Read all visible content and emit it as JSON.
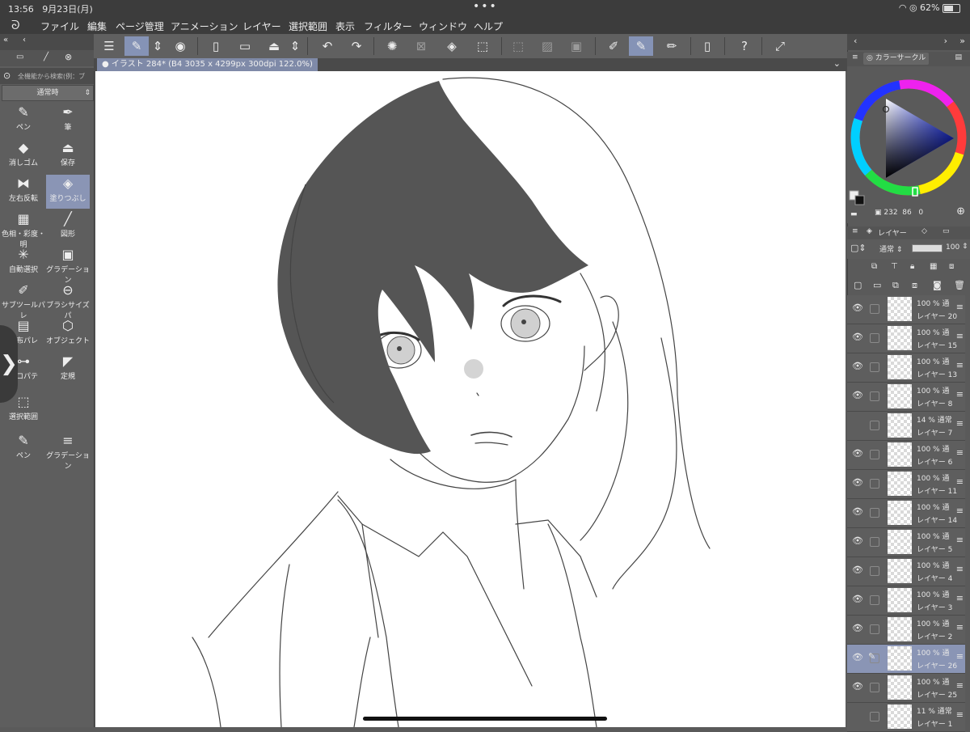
{
  "status": {
    "time": "13:56",
    "date": "9月23日(月)",
    "dots": "•••",
    "battery": "62%"
  },
  "menu": [
    "ファイル",
    "編集",
    "ページ管理",
    "アニメーション",
    "レイヤー",
    "選択範囲",
    "表示",
    "フィルター",
    "ウィンドウ",
    "ヘルプ"
  ],
  "document": {
    "tab_title": "イラスト 284* (B4 3035 x 4299px 300dpi 122.0%)"
  },
  "left_panel": {
    "search_placeholder": "全機能から検索(例：ブ",
    "mode": "通常時",
    "tools": [
      {
        "label": "ペン",
        "icon": "pen-icon",
        "glyph": "✎"
      },
      {
        "label": "筆",
        "icon": "brush-icon",
        "glyph": "✒"
      },
      {
        "label": "消しゴム",
        "icon": "eraser-icon",
        "glyph": "◆"
      },
      {
        "label": "保存",
        "icon": "save-icon",
        "glyph": "⏏"
      },
      {
        "label": "左右反転",
        "icon": "flip-icon",
        "glyph": "⧓"
      },
      {
        "label": "塗りつぶし",
        "icon": "fill-icon",
        "glyph": "◈"
      },
      {
        "label": "色相・彩度・明",
        "icon": "hue-icon",
        "glyph": "▦"
      },
      {
        "label": "図形",
        "icon": "shape-icon",
        "glyph": "╱"
      },
      {
        "label": "自動選択",
        "icon": "auto-select-icon",
        "glyph": "✳"
      },
      {
        "label": "グラデーション",
        "icon": "gradient-icon",
        "glyph": "▣"
      },
      {
        "label": "サブツールパレ",
        "icon": "subtool-icon",
        "glyph": "✐"
      },
      {
        "label": "ブラシサイズパ",
        "icon": "brushsize-icon",
        "glyph": "⊖"
      },
      {
        "label": "分布パレ",
        "icon": "distribution-icon",
        "glyph": "▤"
      },
      {
        "label": "オブジェクト",
        "icon": "object-icon",
        "glyph": "⬡"
      },
      {
        "label": "プロパテ",
        "icon": "property-icon",
        "glyph": "⊶"
      },
      {
        "label": "定規",
        "icon": "ruler-icon",
        "glyph": "◤"
      },
      {
        "label": "選択範囲",
        "icon": "selection-icon",
        "glyph": "⬚"
      },
      {
        "label": "ペン",
        "icon": "pen2-icon",
        "glyph": "✎"
      },
      {
        "label": "グラデーション",
        "icon": "gradient2-icon",
        "glyph": "≡"
      }
    ]
  },
  "right_panel": {
    "color_tab": "カラーサークル",
    "hsv": {
      "h": "232",
      "s": "86",
      "v": "0"
    },
    "layer_tab": "レイヤー",
    "blend_mode": "通常",
    "opacity": "100",
    "layers": [
      {
        "op": "100 %",
        "mode": "通",
        "name": "レイヤー 20",
        "visible": true,
        "selected": false
      },
      {
        "op": "100 %",
        "mode": "通",
        "name": "レイヤー 15",
        "visible": true,
        "selected": false
      },
      {
        "op": "100 %",
        "mode": "通",
        "name": "レイヤー 13",
        "visible": true,
        "selected": false
      },
      {
        "op": "100 %",
        "mode": "通",
        "name": "レイヤー 8",
        "visible": true,
        "selected": false
      },
      {
        "op": "14 %",
        "mode": "通常",
        "name": "レイヤー 7",
        "visible": false,
        "selected": false
      },
      {
        "op": "100 %",
        "mode": "通",
        "name": "レイヤー 6",
        "visible": true,
        "selected": false
      },
      {
        "op": "100 %",
        "mode": "通",
        "name": "レイヤー 11",
        "visible": true,
        "selected": false
      },
      {
        "op": "100 %",
        "mode": "通",
        "name": "レイヤー 14",
        "visible": true,
        "selected": false
      },
      {
        "op": "100 %",
        "mode": "通",
        "name": "レイヤー 5",
        "visible": true,
        "selected": false
      },
      {
        "op": "100 %",
        "mode": "通",
        "name": "レイヤー 4",
        "visible": true,
        "selected": false
      },
      {
        "op": "100 %",
        "mode": "通",
        "name": "レイヤー 3",
        "visible": true,
        "selected": false
      },
      {
        "op": "100 %",
        "mode": "通",
        "name": "レイヤー 2",
        "visible": true,
        "selected": false
      },
      {
        "op": "100 %",
        "mode": "通",
        "name": "レイヤー 26",
        "visible": true,
        "selected": true
      },
      {
        "op": "100 %",
        "mode": "通",
        "name": "レイヤー 25",
        "visible": true,
        "selected": false
      },
      {
        "op": "11 %",
        "mode": "通常",
        "name": "レイヤー 1",
        "visible": false,
        "selected": false
      }
    ]
  },
  "colors": {
    "accent": "#8593b6",
    "panel": "#5a5a5a",
    "dark": "#3c3c3c"
  }
}
